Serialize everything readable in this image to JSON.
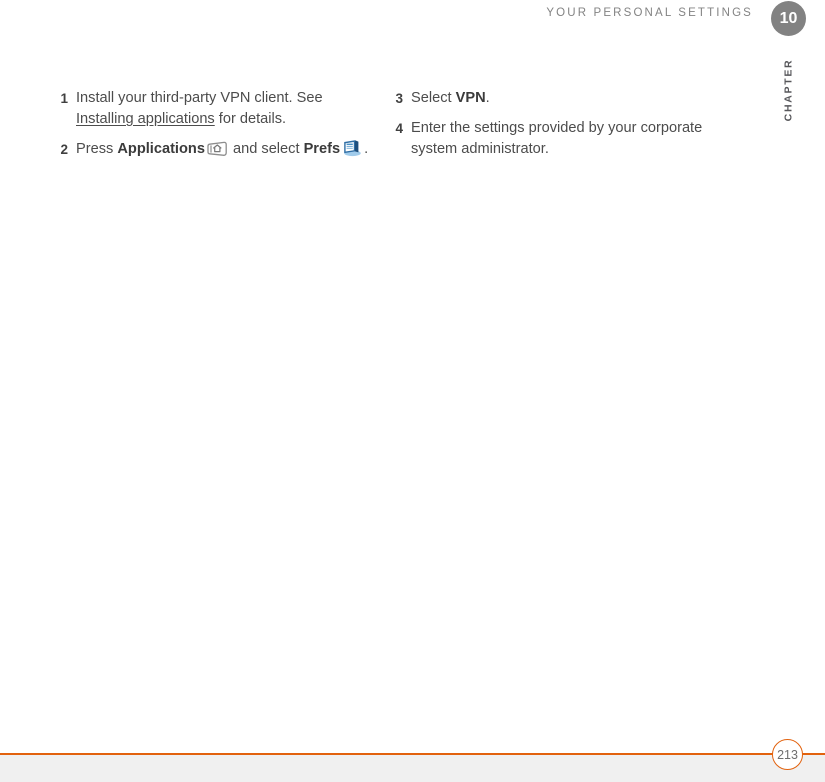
{
  "header": {
    "running_head": "YOUR PERSONAL SETTINGS",
    "chapter_number": "10",
    "chapter_label": "CHAPTER"
  },
  "columns": {
    "left": [
      {
        "number": "1",
        "text_before": "Install your third-party VPN client. See ",
        "xref": "Installing applications",
        "text_after": " for details."
      },
      {
        "number": "2",
        "text_before": "Press ",
        "bold_1": "Applications",
        "icon_1": "applications-icon",
        "text_middle": " and select ",
        "bold_2": "Prefs",
        "icon_2": "prefs-icon",
        "text_after": "."
      }
    ],
    "right": [
      {
        "number": "3",
        "text_before": "Select ",
        "bold_1": "VPN",
        "text_after": "."
      },
      {
        "number": "4",
        "text_before": "Enter the settings provided by your corporate system administrator."
      }
    ]
  },
  "footer": {
    "page_number": "213"
  },
  "colors": {
    "accent_orange": "#e2620e",
    "chapter_gray": "#828282",
    "body_text": "#4c4c4c",
    "footer_band": "#f0f0f0"
  }
}
